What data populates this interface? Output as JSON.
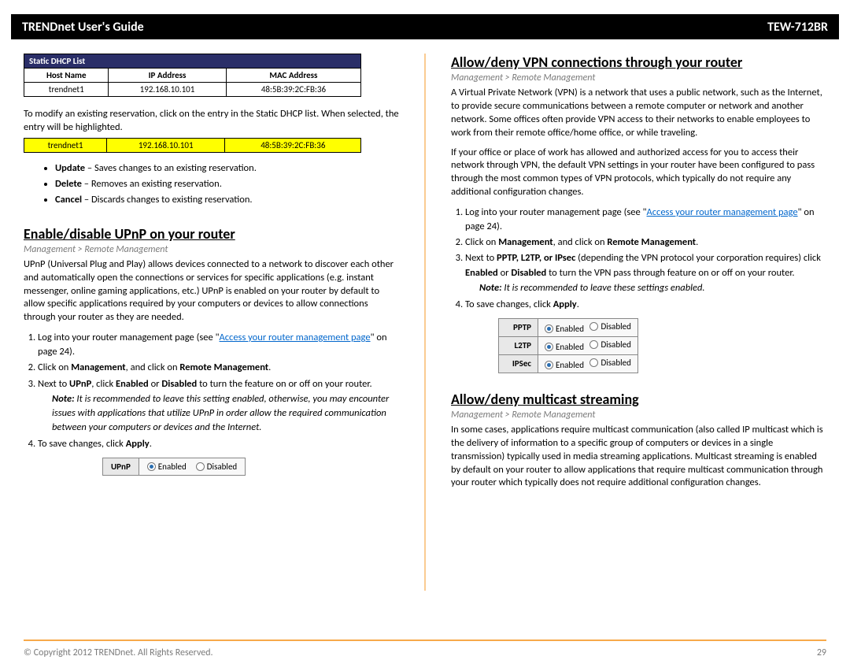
{
  "header": {
    "left": "TRENDnet User's Guide",
    "right": "TEW-712BR"
  },
  "left_col": {
    "dhcp_title": "Static DHCP List",
    "dhcp_headers": [
      "Host Name",
      "IP Address",
      "MAC Address"
    ],
    "dhcp_row": [
      "trendnet1",
      "192.168.10.101",
      "48:5B:39:2C:FB:36"
    ],
    "modify_text": "To modify an existing reservation, click on the entry in the Static DHCP list. When selected, the entry will be highlighted.",
    "hl_row": [
      "trendnet1",
      "192.168.10.101",
      "48:5B:39:2C:FB:36"
    ],
    "actions": [
      {
        "bold": "Update",
        "rest": " – Saves changes to an existing reservation."
      },
      {
        "bold": "Delete",
        "rest": " – Removes an existing reservation."
      },
      {
        "bold": "Cancel",
        "rest": " – Discards changes to existing reservation."
      }
    ],
    "section_upnp": "Enable/disable UPnP on your router",
    "breadcrumb": "Management > Remote Management",
    "upnp_body": "UPnP (Universal Plug and Play) allows devices connected to a network to discover each other and automatically open the connections or services for specific applications (e.g. instant messenger, online gaming applications, etc.) UPnP is enabled on your router by default to allow specific applications required by your computers or devices to allow connections through your router as they are needed.",
    "step1_a": "Log into your router management page (see \"",
    "step1_link": "Access your router management page",
    "step1_b": "\" on page 24).",
    "step2_a": "Click on ",
    "step2_b": "Management",
    "step2_c": ", and click on ",
    "step2_d": "Remote Management",
    "step2_e": ".",
    "step3_a": "Next to ",
    "step3_b": "UPnP",
    "step3_c": ", click ",
    "step3_d": "Enabled",
    "step3_e": " or ",
    "step3_f": "Disabled",
    "step3_g": " to turn the feature on or off on your router.",
    "note_a": "Note:",
    "note_b": " It is recommended to leave this setting enabled, otherwise, you may encounter issues with applications that utilize UPnP in order allow the required communication between your computers or devices and the Internet.",
    "step4_a": "To save changes, click ",
    "step4_b": "Apply",
    "step4_c": ".",
    "upnp_label": "UPnP",
    "enabled": "Enabled",
    "disabled": "Disabled"
  },
  "right_col": {
    "section_vpn": "Allow/deny VPN connections through your router",
    "breadcrumb": "Management > Remote Management",
    "vpn_body1": "A Virtual Private Network (VPN) is a network that uses a public network, such as the Internet, to provide secure communications between a remote computer or network and another network. Some offices often provide VPN access to their networks to enable employees to work from their remote office/home office, or while traveling.",
    "vpn_body2": "If your office or place of work has allowed and authorized access for you to access their network through VPN, the default VPN settings in your router have been configured to pass through the most common types of VPN protocols, which typically do not require any additional configuration changes.",
    "step1_a": "Log into your router management page (see \"",
    "step1_link": "Access your router management page",
    "step1_b": "\" on page 24).",
    "step2_a": "Click on ",
    "step2_b": "Management",
    "step2_c": ", and click on ",
    "step2_d": "Remote Management",
    "step2_e": ".",
    "step3_a": "Next to ",
    "step3_b": "PPTP, L2TP, or IPsec",
    "step3_c": " (depending the VPN protocol your corporation requires) click ",
    "step3_d": "Enabled",
    "step3_e": " or ",
    "step3_f": "Disabled",
    "step3_g": " to turn the VPN pass through feature on or off on your router.",
    "note_a": "Note:",
    "note_b": " It is recommended to leave these settings enabled.",
    "step4_a": "To save changes, click ",
    "step4_b": "Apply",
    "step4_c": ".",
    "vpn_rows": [
      "PPTP",
      "L2TP",
      "IPSec"
    ],
    "enabled": "Enabled",
    "disabled": "Disabled",
    "section_mc": "Allow/deny multicast streaming",
    "mc_body": "In some cases, applications require multicast communication (also called IP multicast which is the delivery of information to a specific group of computers or devices in a single transmission) typically used in media streaming applications. Multicast streaming is enabled by default on your router to allow applications that require multicast communication through your router which typically does not require additional configuration changes."
  },
  "footer": {
    "copyright": "© Copyright 2012 TRENDnet. All Rights Reserved.",
    "page": "29"
  }
}
